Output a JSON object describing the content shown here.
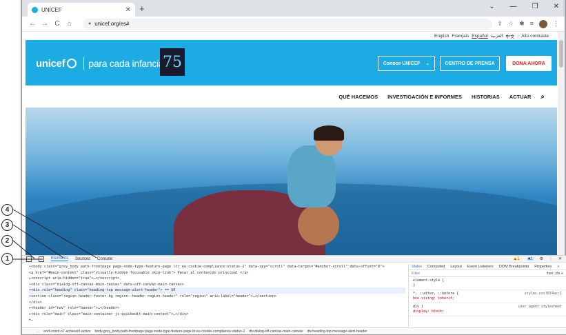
{
  "browser": {
    "tab_title": "UNICEF",
    "new_tab": "+",
    "window_controls": [
      "⌄",
      "—",
      "❐",
      "✕"
    ],
    "url": "unicef.org/es#",
    "nav_icons": [
      "←",
      "→",
      "C",
      "⌂"
    ],
    "right_icons": [
      "⇪",
      "☆",
      "✱",
      "≡"
    ]
  },
  "languages": {
    "items": [
      "English",
      "Français",
      "Español",
      "العربية",
      "中文"
    ],
    "active": "Español",
    "contrast": "Alto contraste"
  },
  "header": {
    "logo": "unicef",
    "tagline": "para cada infancia",
    "badge": "75",
    "conoce": "Conoce UNICEF",
    "prensa": "CENTRO DE PRENSA",
    "dona": "DONA AHORA",
    "colors": {
      "brand": "#1cabe2",
      "donate_text": "#e2231a"
    }
  },
  "nav": {
    "items": [
      "QUÉ HACEMOS",
      "INVESTIGACIÓN E INFORMES",
      "HISTORIAS",
      "ACTUAR"
    ],
    "search_icon": "search-icon"
  },
  "callouts": [
    "1",
    "2",
    "3",
    "4"
  ],
  "devtools": {
    "tabs": [
      "Elements",
      "Sources",
      "Console"
    ],
    "active_tab": "Elements",
    "warn_count": "▲1",
    "info_count": "■1",
    "dom_lines": [
      "▾<body class=\"grey_body path-frontpage page-node-type-feature-page ltr eu-cookie-compliance-status-2\" data-spy=\"scroll\" data-target=\"#anchor-scroll\" data-offset=\"0\">",
      "   <a href=\"#main-content\" class=\"visually-hidden focusable skip-link\"> Pasar al contenido principal </a>",
      "  ▸<noscript aria-hidden=\"true\">…</noscript>",
      "  ▾<div class=\"dialog-off-canvas-main-canvas\" data-off-canvas-main-canvas>",
      "   ▾<div role=\"heading\" class=\"heading-top message-alert-header\"> == $0",
      "      <section class=\"region header-footer-bg region--header region-header\" role=\"region\" aria-label=\"header\">…</section>",
      "     </div>",
      "   ▸<header id=\"nav\" role=\"banner\">…</header>",
      "   ▸<div role=\"main\" class=\"main-container js-quickedit-main-content\">…</div>",
      "   ▸…"
    ],
    "selected_line": 4,
    "styles_tabs": [
      "Styles",
      "Computed",
      "Layout",
      "Event Listeners",
      "DOM Breakpoints",
      "Properties",
      "»"
    ],
    "filter_placeholder": "Filter",
    "filter_tools": ":hov  .cls  +",
    "rules": [
      {
        "selector": "element.style {",
        "body": "}",
        "source": ""
      },
      {
        "selector": "*, ::after, ::before {",
        "body": "box-sizing: inherit;",
        "source": "styles.css?874ac:1"
      },
      {
        "selector": "div {",
        "body": "display: block;",
        "source": "user agent stylesheet"
      }
    ],
    "breadcrumbs": [
      "…",
      "eref-cnsnf-n7-achieve#-active",
      "body.grey_body.path-frontpage.page-node-type-feature-page.ltr.eu-cookie-compliance-status-2",
      "div.dialog-off-canvas-main-canvas",
      "div.heading-top.message-alert-header"
    ]
  }
}
